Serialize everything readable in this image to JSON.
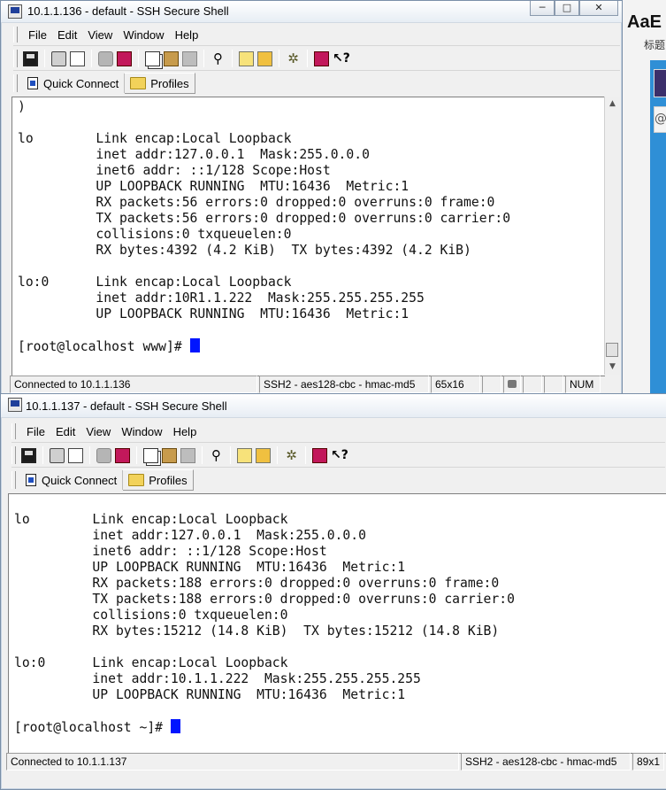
{
  "background": {
    "title_fragment": "AaE",
    "subtitle_fragment": "标题"
  },
  "menu": {
    "file": "File",
    "edit": "Edit",
    "view": "View",
    "window": "Window",
    "help": "Help"
  },
  "toolbar": {
    "quick_connect": "Quick Connect",
    "profiles": "Profiles",
    "icons": [
      "save-icon",
      "print-icon",
      "print-preview-icon",
      "disconnect-icon",
      "reconnect-icon",
      "copy-icon",
      "paste-icon",
      "paste-special-icon",
      "find-icon",
      "settings-icon",
      "profile-settings-icon",
      "gear-icon",
      "help-book-icon",
      "context-help-icon"
    ]
  },
  "window1": {
    "title": "10.1.1.136 - default - SSH Secure Shell",
    "window_buttons": {
      "minimize": "─",
      "maximize": "□",
      "close": "✕"
    },
    "terminal_lines": [
      ")",
      "",
      "lo        Link encap:Local Loopback",
      "          inet addr:127.0.0.1  Mask:255.0.0.0",
      "          inet6 addr: ::1/128 Scope:Host",
      "          UP LOOPBACK RUNNING  MTU:16436  Metric:1",
      "          RX packets:56 errors:0 dropped:0 overruns:0 frame:0",
      "          TX packets:56 errors:0 dropped:0 overruns:0 carrier:0",
      "          collisions:0 txqueuelen:0",
      "          RX bytes:4392 (4.2 KiB)  TX bytes:4392 (4.2 KiB)",
      "",
      "lo:0      Link encap:Local Loopback",
      "          inet addr:10R1.1.222  Mask:255.255.255.255",
      "          UP LOOPBACK RUNNING  MTU:16436  Metric:1",
      "",
      "[root@localhost www]# "
    ],
    "status": {
      "connection": "Connected to 10.1.1.136",
      "protocol": "SSH2 - aes128-cbc - hmac-md5",
      "size": "65x16",
      "num": "NUM"
    }
  },
  "window2": {
    "title": "10.1.1.137 - default - SSH Secure Shell",
    "terminal_lines": [
      "",
      "lo        Link encap:Local Loopback",
      "          inet addr:127.0.0.1  Mask:255.0.0.0",
      "          inet6 addr: ::1/128 Scope:Host",
      "          UP LOOPBACK RUNNING  MTU:16436  Metric:1",
      "          RX packets:188 errors:0 dropped:0 overruns:0 frame:0",
      "          TX packets:188 errors:0 dropped:0 overruns:0 carrier:0",
      "          collisions:0 txqueuelen:0",
      "          RX bytes:15212 (14.8 KiB)  TX bytes:15212 (14.8 KiB)",
      "",
      "lo:0      Link encap:Local Loopback",
      "          inet addr:10.1.1.222  Mask:255.255.255.255",
      "          UP LOOPBACK RUNNING  MTU:16436  Metric:1",
      "",
      "[root@localhost ~]# "
    ],
    "status": {
      "connection": "Connected to 10.1.1.137",
      "protocol": "SSH2 - aes128-cbc - hmac-md5",
      "size": "89x1"
    }
  }
}
